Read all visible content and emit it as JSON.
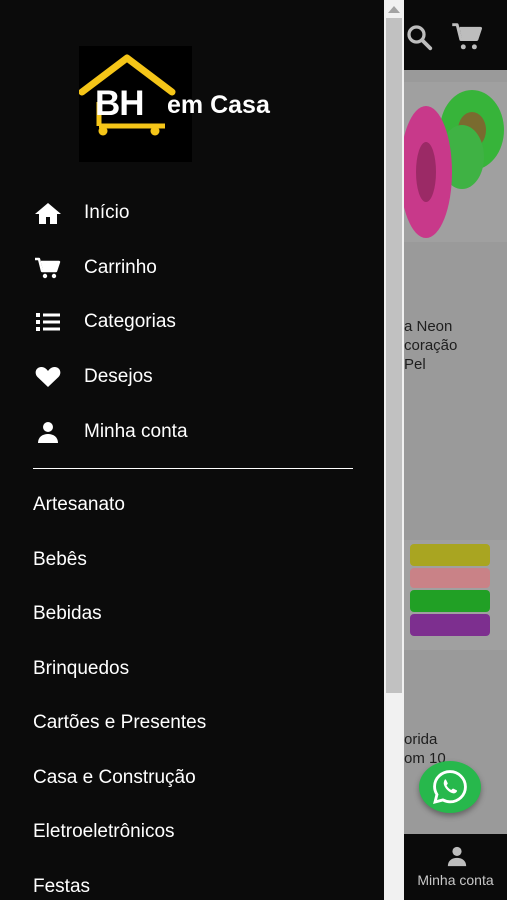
{
  "brand": {
    "logo_badge": "BH",
    "logo_suffix": "em Casa",
    "logo_color": "#f5c518"
  },
  "nav": [
    {
      "label": "Início",
      "icon": "home-icon"
    },
    {
      "label": "Carrinho",
      "icon": "cart-icon"
    },
    {
      "label": "Categorias",
      "icon": "list-icon"
    },
    {
      "label": "Desejos",
      "icon": "heart-icon"
    },
    {
      "label": "Minha conta",
      "icon": "user-icon"
    }
  ],
  "categories": [
    "Artesanato",
    "Bebês",
    "Bebidas",
    "Brinquedos",
    "Cartões e Presentes",
    "Casa e Construção",
    "Eletroeletrônicos",
    "Festas"
  ],
  "background_page": {
    "product_1_fragment": "a Neon\ncoração\nPel",
    "product_2_fragment": "orida\nom 10",
    "bottom_nav_account_label": "Minha conta"
  },
  "colors": {
    "drawer_bg": "#0b0b0b",
    "whatsapp_green": "#27b84c",
    "accent_yellow": "#f5c518"
  }
}
